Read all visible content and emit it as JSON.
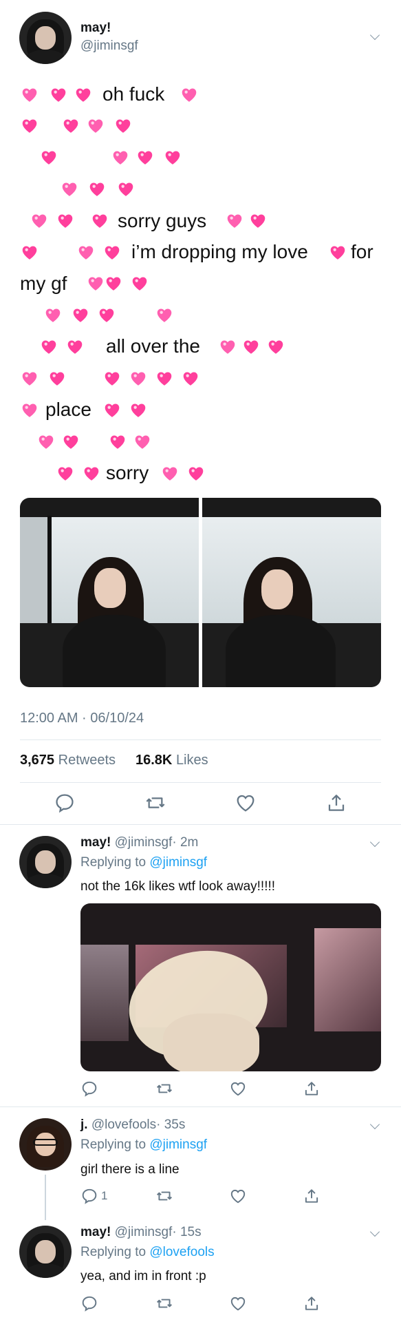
{
  "main_tweet": {
    "display_name": "may!",
    "handle": "@jiminsgf",
    "lines": [
      "oh fuck",
      "sorry guys",
      "i’m dropping my love",
      "for",
      "my gf",
      "all over the",
      "place",
      "sorry"
    ],
    "timestamp": "12:00 AM · 06/10/24",
    "retweets_count": "3,675",
    "retweets_label": "Retweets",
    "likes_count": "16.8K",
    "likes_label": "Likes"
  },
  "replies": [
    {
      "display_name": "may!",
      "handle": "@jiminsgf",
      "time": "· 2m",
      "replying_prefix": "Replying to",
      "replying_to": "@jiminsgf",
      "text": "not the 16k likes wtf look away!!!!!"
    },
    {
      "display_name": "j.",
      "handle": "@lovefools",
      "time": "· 35s",
      "replying_prefix": "Replying to",
      "replying_to": "@jiminsgf",
      "text": "girl there is a line",
      "reply_count": "1"
    },
    {
      "display_name": "may!",
      "handle": "@jiminsgf",
      "time": "· 15s",
      "replying_prefix": "Replying to",
      "replying_to": "@lovefools",
      "text": "yea, and im in front :p"
    }
  ],
  "icons": {
    "heart_emoji": "emoji-heart-icon",
    "reply": "reply-icon",
    "retweet": "retweet-icon",
    "like": "like-icon",
    "share": "share-icon",
    "more": "chevron-down-icon"
  },
  "colors": {
    "link": "#1da1f2",
    "muted": "#657786",
    "heart_pink": "#ff3f9c",
    "divider": "#e1e8ed"
  }
}
